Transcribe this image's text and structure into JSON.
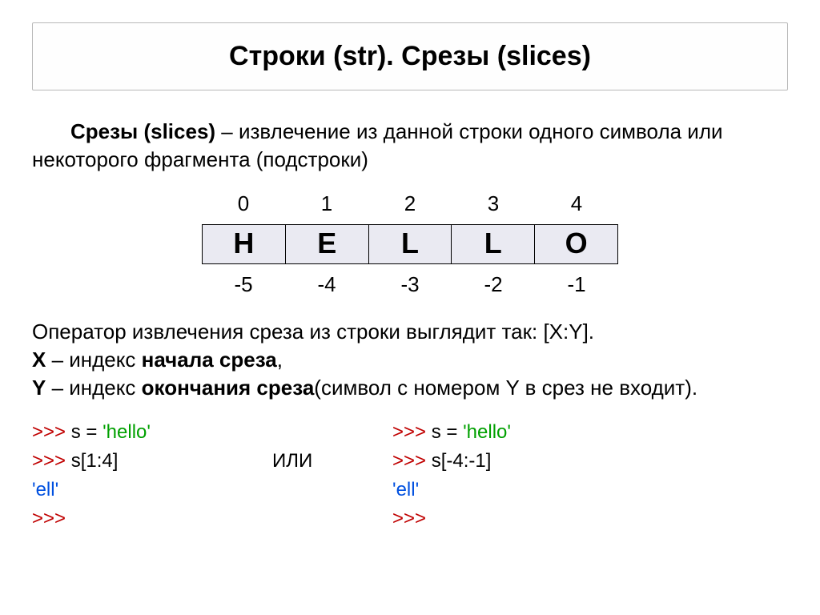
{
  "title": "Строки (str). Срезы (slices)",
  "intro": {
    "term": "Срезы (slices)",
    "rest": " – извлечение из данной строки одного символа или некоторого фрагмента (подстроки)"
  },
  "diagram": {
    "top": [
      "0",
      "1",
      "2",
      "3",
      "4"
    ],
    "letters": [
      "H",
      "E",
      "L",
      "L",
      "O"
    ],
    "bottom": [
      "-5",
      "-4",
      "-3",
      "-2",
      "-1"
    ]
  },
  "operator": {
    "line1": "Оператор извлечения среза из строки выглядит так: [X:Y].",
    "line2a": "X",
    "line2b": " – индекс ",
    "line2c": "начала среза",
    "line2d": ",",
    "line3a": "Y",
    "line3b": " – индекс ",
    "line3c": "окончания среза",
    "line3d": "(символ с номером Y в срез не входит)."
  },
  "code": {
    "left": {
      "l1a": ">>> ",
      "l1b": "s = ",
      "l1c": "'hello'",
      "l2a": ">>> ",
      "l2b": "s[1:4]",
      "l3": "'ell'",
      "l4": ">>>"
    },
    "mid": "ИЛИ",
    "right": {
      "l1a": ">>> ",
      "l1b": "s = ",
      "l1c": "'hello'",
      "l2a": ">>> ",
      "l2b": "s[-4:-1]",
      "l3": "'ell'",
      "l4": ">>>"
    }
  }
}
